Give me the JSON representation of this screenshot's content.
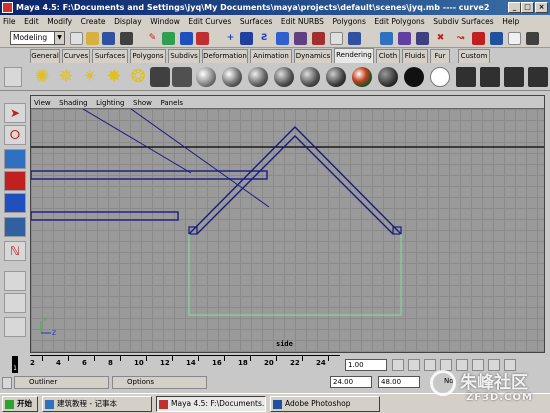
{
  "window": {
    "title": "Maya 4.5: F:\\Documents and Settings\\jyq\\My Documents\\maya\\projects\\default\\scenes\\jyq.mb  ----  curve2",
    "controls": [
      "_",
      "□",
      "×"
    ]
  },
  "menubar": [
    "File",
    "Edit",
    "Modify",
    "Create",
    "Display",
    "Window",
    "Edit Curves",
    "Surfaces",
    "Edit NURBS",
    "Polygons",
    "Edit Polygons",
    "Subdiv Surfaces",
    "Help"
  ],
  "toolbar": {
    "mode": "Modeling"
  },
  "shelf_tabs": [
    "General",
    "Curves",
    "Surfaces",
    "Polygons",
    "Subdivs",
    "Deformation",
    "Animation",
    "Dynamics",
    "Rendering",
    "Cloth",
    "Fluids",
    "Fur",
    "Custom"
  ],
  "shelf_active_tab": "Rendering",
  "viewport": {
    "menu": [
      "View",
      "Shading",
      "Lighting",
      "Show",
      "Panels"
    ],
    "camera_label": "side",
    "axis_labels": {
      "y": "Y",
      "z": "Z"
    }
  },
  "timeslider": {
    "ticks": [
      "2",
      "4",
      "6",
      "8",
      "10",
      "12",
      "14",
      "16",
      "18",
      "20",
      "22",
      "24"
    ],
    "current_frame": "1",
    "current_time_field": "1.00"
  },
  "range": {
    "start": "24.00",
    "end": "48.00",
    "partial_label": "No"
  },
  "panels": [
    {
      "label": "Outliner"
    },
    {
      "label": "Options"
    }
  ],
  "taskbar": {
    "start_label": "开始",
    "items": [
      "建筑教程 - 记事本",
      "Maya 4.5: F:\\Documents...",
      "Adobe Photoshop"
    ]
  },
  "watermark": {
    "text": "朱峰社区",
    "url": "ZF3D.COM"
  },
  "colors": {
    "titlebar": "#0a246a",
    "viewport_bg": "#9a9a9a",
    "curve_blue": "#1a1a80",
    "curve_green": "#80e0a0",
    "active_tab": "#e8e8e8"
  }
}
